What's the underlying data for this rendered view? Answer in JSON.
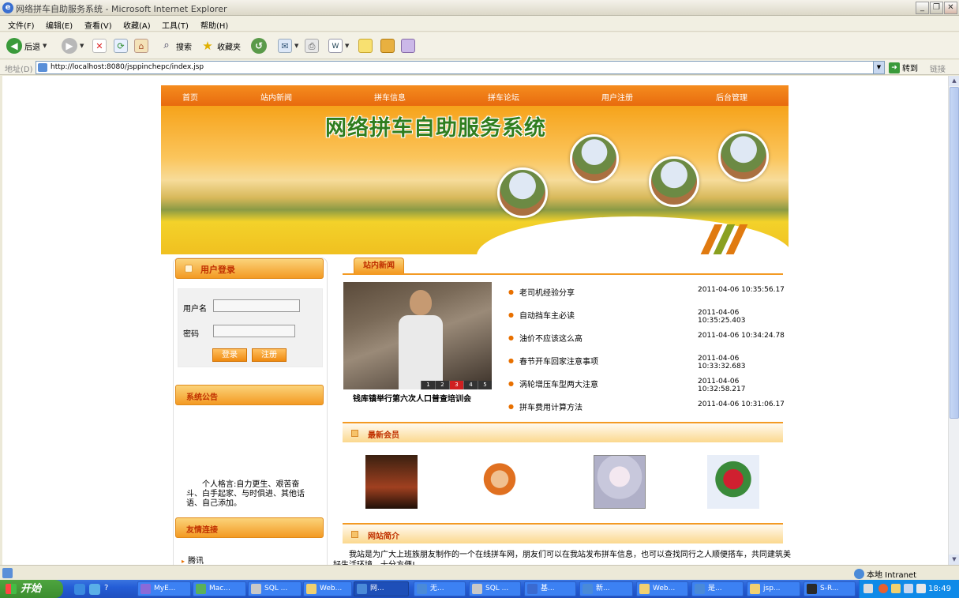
{
  "window": {
    "title": "网络拼车自助服务系统 - Microsoft Internet Explorer"
  },
  "menu": [
    "文件(F)",
    "编辑(E)",
    "查看(V)",
    "收藏(A)",
    "工具(T)",
    "帮助(H)"
  ],
  "toolbar": {
    "back": "后退",
    "search": "搜索",
    "favorites": "收藏夹"
  },
  "address": {
    "label": "地址(D)",
    "url": "http://localhost:8080/jsppinchepc/index.jsp",
    "go": "转到",
    "links": "链接"
  },
  "site": {
    "nav": [
      "首页",
      "站内新闻",
      "拼车信息",
      "拼车论坛",
      "用户注册",
      "后台管理"
    ],
    "banner_title": "网络拼车自助服务系统",
    "login": {
      "title": "用户登录",
      "username_label": "用户名",
      "password_label": "密码",
      "login_btn": "登录",
      "register_btn": "注册"
    },
    "notice_title": "系统公告",
    "motto": "个人格言:自力更生、艰苦奋斗、白手起家、与时俱进、其他话语、自己添加。",
    "friend_links_title": "友情连接",
    "friend_links": [
      "腾讯"
    ],
    "news_tab": "站内新闻",
    "photo_caption": "钱库镇举行第六次人口普查培训会",
    "photo_pages": [
      "1",
      "2",
      "3",
      "4",
      "5"
    ],
    "news": [
      {
        "title": "老司机经验分享",
        "date": "2011-04-06 10:35:56.17"
      },
      {
        "title": "自动挡车主必读",
        "date": "2011-04-06 10:35:25.403"
      },
      {
        "title": "油价不应该这么高",
        "date": "2011-04-06 10:34:24.78"
      },
      {
        "title": "春节开车回家注意事项",
        "date": "2011-04-06 10:33:32.683"
      },
      {
        "title": "涡轮增压车型两大注意",
        "date": "2011-04-06 10:32:58.217"
      },
      {
        "title": "拼车费用计算方法",
        "date": "2011-04-06 10:31:06.17"
      }
    ],
    "members_title": "最新会员",
    "intro_title": "网站简介",
    "intro_text": "我站是为广大上班族朋友制作的一个在线拼车网，朋友们可以在我站发布拼车信息，也可以查找同行之人顺便搭车，共同建筑美好生活环境，十分方便!"
  },
  "status": {
    "zone": "本地 Intranet"
  },
  "taskbar": {
    "start": "开始",
    "tasks": [
      "MyE...",
      "Mac...",
      "SQL ...",
      "Web...",
      "网...",
      "无...",
      "SQL ...",
      "基...",
      "新...",
      "Web...",
      "是...",
      "jsp...",
      "S-R..."
    ],
    "clock": "18:49"
  },
  "colors": {
    "nav_orange": "#e86b0e",
    "title_green": "#2f7d1e",
    "head_text": "#c03000"
  }
}
